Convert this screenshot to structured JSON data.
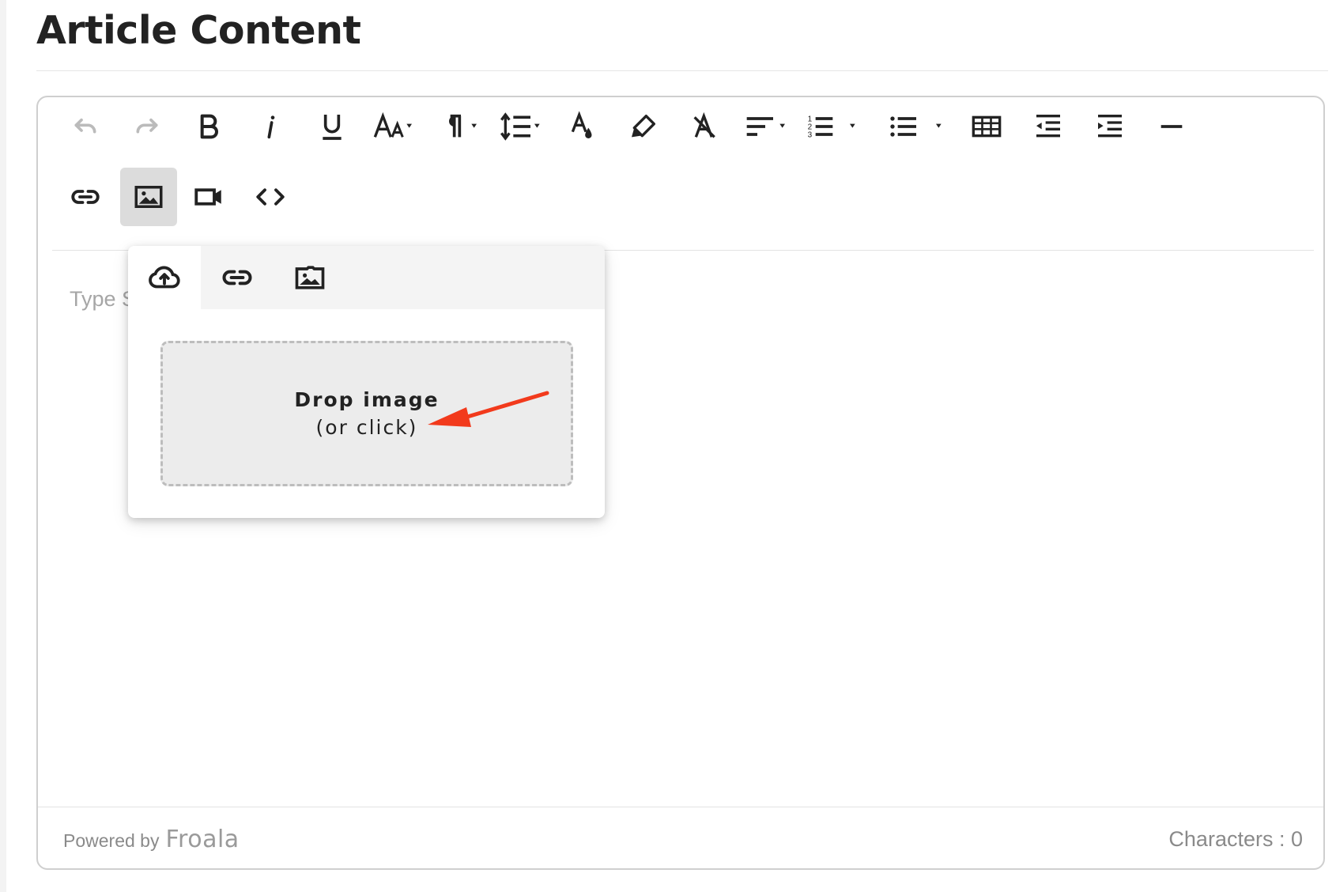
{
  "page": {
    "title": "Article Content"
  },
  "toolbar": {
    "buttons": [
      {
        "name": "undo",
        "icon": "undo-icon"
      },
      {
        "name": "redo",
        "icon": "redo-icon"
      },
      {
        "name": "bold",
        "icon": "bold-icon"
      },
      {
        "name": "italic",
        "icon": "italic-icon"
      },
      {
        "name": "underline",
        "icon": "underline-icon"
      },
      {
        "name": "font-size",
        "icon": "font-size-icon"
      },
      {
        "name": "paragraph-format",
        "icon": "paragraph-icon"
      },
      {
        "name": "line-height",
        "icon": "line-height-icon"
      },
      {
        "name": "text-color",
        "icon": "text-color-icon"
      },
      {
        "name": "highlight",
        "icon": "highlighter-icon"
      },
      {
        "name": "clear-formatting",
        "icon": "clear-format-icon"
      },
      {
        "name": "align",
        "icon": "align-left-icon"
      },
      {
        "name": "ordered-list",
        "icon": "ordered-list-icon"
      },
      {
        "name": "unordered-list",
        "icon": "unordered-list-icon"
      },
      {
        "name": "insert-table",
        "icon": "table-icon"
      },
      {
        "name": "outdent",
        "icon": "outdent-icon"
      },
      {
        "name": "indent",
        "icon": "indent-icon"
      },
      {
        "name": "horizontal-line",
        "icon": "horizontal-line-icon"
      },
      {
        "name": "insert-link",
        "icon": "link-icon"
      },
      {
        "name": "insert-image",
        "icon": "image-icon",
        "active": true
      },
      {
        "name": "insert-video",
        "icon": "video-icon"
      },
      {
        "name": "code-view",
        "icon": "code-icon"
      }
    ]
  },
  "editor": {
    "placeholder": "Type S"
  },
  "image_popup": {
    "tabs": [
      {
        "name": "upload",
        "icon": "cloud-upload-icon",
        "selected": true
      },
      {
        "name": "by-url",
        "icon": "link-icon"
      },
      {
        "name": "manager",
        "icon": "image-icon"
      }
    ],
    "dropzone": {
      "main": "Drop image",
      "sub": "(or click)"
    }
  },
  "footer": {
    "powered_label": "Powered by",
    "brand": "Froala",
    "char_count": "Characters : 0"
  },
  "colors": {
    "accent_arrow": "#f23a1c",
    "active_button": "#dcdcdc",
    "border": "#cfcfcf"
  }
}
